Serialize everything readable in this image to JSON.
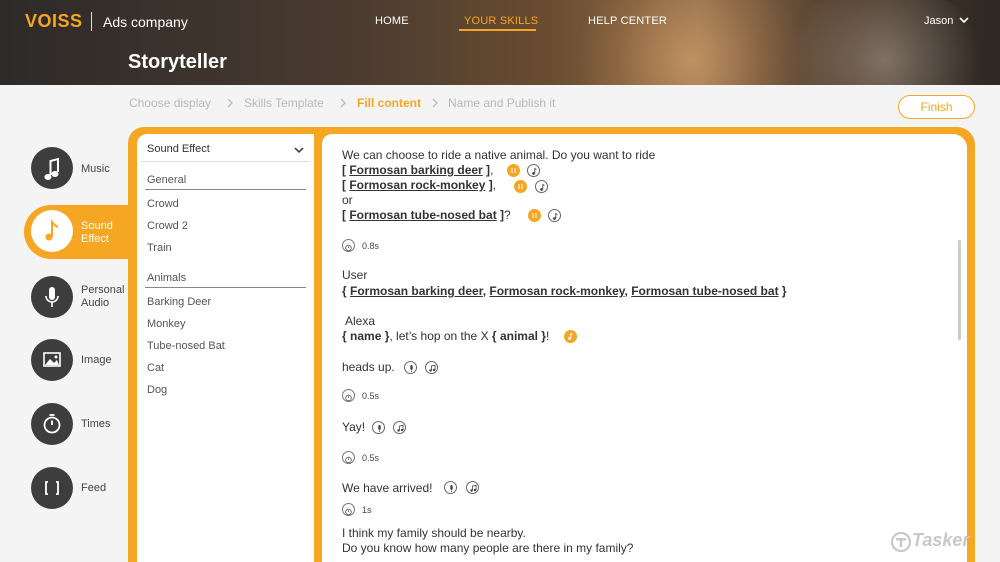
{
  "header": {
    "logo": "VOISS",
    "company": "Ads company",
    "nav": [
      "HOME",
      "YOUR SKILLS",
      "HELP CENTER"
    ],
    "active_nav": "YOUR SKILLS",
    "user": "Jason",
    "page_title": "Storyteller"
  },
  "breadcrumb": {
    "steps": [
      "Choose display",
      "Skills Template",
      "Fill content",
      "Name and Publish it"
    ],
    "active": "Fill content",
    "finish_label": "Finish"
  },
  "tools": [
    {
      "label": "Music",
      "icon": "music-note-icon"
    },
    {
      "label": "Sound Effect",
      "icon": "music-note-icon"
    },
    {
      "label": "Personal Audio",
      "icon": "microphone-icon"
    },
    {
      "label": "Image",
      "icon": "image-icon"
    },
    {
      "label": "Times",
      "icon": "timer-icon"
    },
    {
      "label": "Feed",
      "icon": "brackets-icon"
    }
  ],
  "active_tool": "Sound Effect",
  "sound_panel": {
    "dropdown": "Sound Effect",
    "groups": [
      {
        "title": "General",
        "items": [
          "Crowd",
          "Crowd 2",
          "Train"
        ]
      },
      {
        "title": "Animals",
        "items": [
          "Barking Deer",
          "Monkey",
          "Tube-nosed Bat",
          "Cat",
          "Dog"
        ]
      }
    ]
  },
  "script": {
    "intro": "We can choose to ride a native animal. Do you want to ride",
    "option1": "Formosan barking deer",
    "option2": "Formosan rock-monkey",
    "or_text": "or",
    "option3": "Formosan tube-nosed bat",
    "pause1": "0.8s",
    "user_label": "User",
    "user_options": [
      "Formosan barking deer",
      "Formosan rock-monkey",
      "Formosan tube-nosed bat"
    ],
    "alexa_label": "Alexa",
    "alexa_name": "name",
    "alexa_mid": ", let’s hop on the X",
    "alexa_animal": "animal",
    "line_heads": "heads up.",
    "pause2": "0.5s",
    "line_yay": "Yay!",
    "pause3": "0.5s",
    "line_arrived": "We have arrived!",
    "pause4": "1s",
    "line_family1": "I think my family should be nearby.",
    "line_family2": "Do you know how many people are there in my family?"
  },
  "watermark": "Tasker",
  "colors": {
    "accent": "#f5a623",
    "dark_icon": "#3d3d3d"
  }
}
